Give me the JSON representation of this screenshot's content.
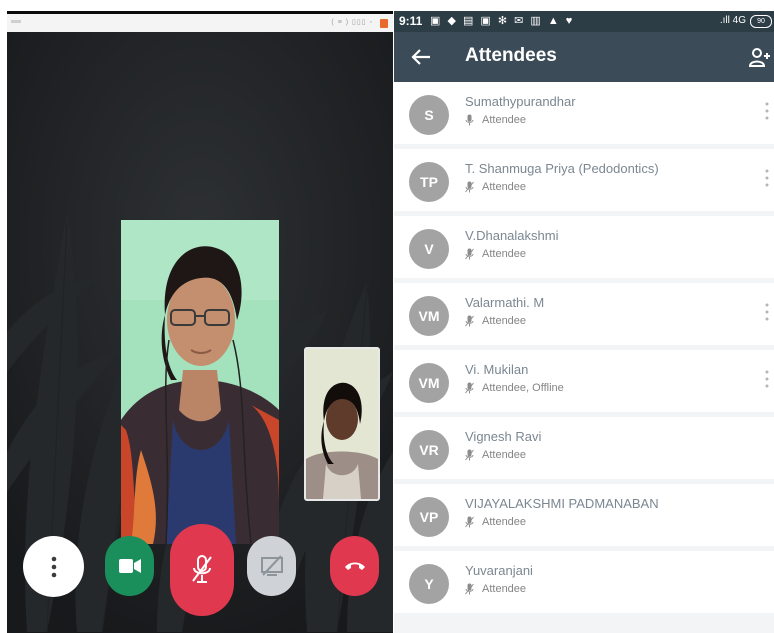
{
  "call": {
    "controls": {
      "more": "more-vert-icon",
      "camera": "videocam-icon",
      "mic": "mic-off-icon",
      "share": "screen-share-off-icon",
      "hangup": "call-end-icon"
    },
    "colors": {
      "camera": "#1a8f5c",
      "mic": "#e0384f",
      "hangup": "#e0384f",
      "share": "#cfd3d8"
    }
  },
  "phone_status": {
    "time": "9:11",
    "network": ".ıll 4G",
    "battery": "90"
  },
  "app_bar": {
    "title": "Attendees",
    "back_icon": "arrow-back-icon",
    "add_icon": "person-add-icon"
  },
  "attendees": [
    {
      "initials": "S",
      "name": "Sumathypurandhar",
      "role": "Attendee",
      "mic": "mic-icon",
      "menu": true
    },
    {
      "initials": "TP",
      "name": "T. Shanmuga Priya (Pedodontics)",
      "role": "Attendee",
      "mic": "mic-off-icon",
      "menu": true
    },
    {
      "initials": "V",
      "name": "V.Dhanalakshmi",
      "role": "Attendee",
      "mic": "mic-off-icon",
      "menu": false
    },
    {
      "initials": "VM",
      "name": "Valarmathi. M",
      "role": "Attendee",
      "mic": "mic-off-icon",
      "menu": true
    },
    {
      "initials": "VM",
      "name": "Vi. Mukilan",
      "role": "Attendee, Offline",
      "mic": "mic-off-icon",
      "menu": true
    },
    {
      "initials": "VR",
      "name": "Vignesh Ravi",
      "role": "Attendee",
      "mic": "mic-off-icon",
      "menu": false
    },
    {
      "initials": "VP",
      "name": "VIJAYALAKSHMI PADMANABAN",
      "role": "Attendee",
      "mic": "mic-off-icon",
      "menu": false
    },
    {
      "initials": "Y",
      "name": "Yuvaranjani",
      "role": "Attendee",
      "mic": "mic-off-icon",
      "menu": false
    }
  ]
}
